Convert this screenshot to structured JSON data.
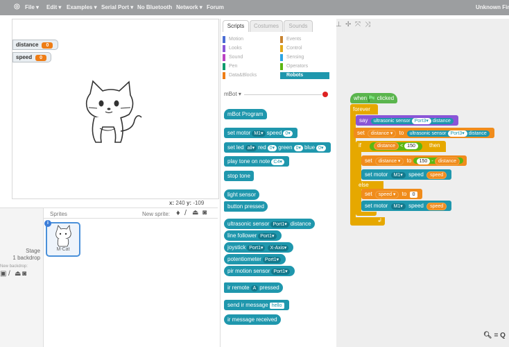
{
  "menu": {
    "items": [
      "File ▾",
      "Edit ▾",
      "Examples ▾",
      "Serial Port ▾",
      "No Bluetooth",
      "Network ▾",
      "Forum"
    ],
    "user": "Unknown Fir"
  },
  "stage": {
    "monitors": [
      {
        "label": "distance",
        "value": "0"
      },
      {
        "label": "speed",
        "value": "0"
      }
    ],
    "coords": {
      "x_label": "x:",
      "x": "240",
      "y_label": "y:",
      "y": "-109"
    }
  },
  "sprites": {
    "header": "Sprites",
    "new_sprite": "New sprite:",
    "sprite_name": "M-Cat",
    "info": "i",
    "stage_label": "Stage",
    "backdrop_count": "1 backdrop",
    "new_backdrop": "New backdrop:"
  },
  "palette": {
    "tabs": [
      "Scripts",
      "Costumes",
      "Sounds"
    ],
    "categories": [
      {
        "name": "Motion",
        "color": "#4a6cd4"
      },
      {
        "name": "Events",
        "color": "#c88330"
      },
      {
        "name": "Looks",
        "color": "#8a55d7"
      },
      {
        "name": "Control",
        "color": "#e1a91a"
      },
      {
        "name": "Sound",
        "color": "#bb42c3"
      },
      {
        "name": "Sensing",
        "color": "#2ca5e2"
      },
      {
        "name": "Pen",
        "color": "#0e9a6c"
      },
      {
        "name": "Operators",
        "color": "#5cb712"
      },
      {
        "name": "Data&Blocks",
        "color": "#ee7d16"
      },
      {
        "name": "Robots",
        "color": "#1f97ad"
      }
    ],
    "device": "mBot ▾",
    "blocks": {
      "program": "mBot Program",
      "set_motor": {
        "a": "set motor",
        "b": "M1▾",
        "c": "speed",
        "d": "0▾"
      },
      "set_led": {
        "a": "set led",
        "b": "all▾",
        "c": "red",
        "d": "0▾",
        "e": "green",
        "f": "0▾",
        "g": "blue",
        "h": "0▾"
      },
      "play_tone": {
        "a": "play tone on note",
        "b": "C4▾"
      },
      "stop_tone": "stop tone",
      "light_sensor": "light sensor",
      "button_pressed": "button pressed",
      "ultrasonic": {
        "a": "ultrasonic sensor",
        "b": "Port1▾",
        "c": "distance"
      },
      "line_follower": {
        "a": "line follower",
        "b": "Port1▾"
      },
      "joystick": {
        "a": "joystick",
        "b": "Port1▾",
        "c": "X-Axis▾"
      },
      "potentiometer": {
        "a": "potentiometer",
        "b": "Port1▾"
      },
      "pir": {
        "a": "pir motion sensor",
        "b": "Port1▾"
      },
      "ir_remote": {
        "a": "ir remote",
        "b": "A",
        "c": "pressed"
      },
      "send_ir": {
        "a": "send ir message",
        "b": "hello"
      },
      "ir_received": "ir message received"
    }
  },
  "script": {
    "when": "when",
    "clicked": "clicked",
    "forever": "forever",
    "say": {
      "a": "say",
      "b": "ultrasonic sensor",
      "c": "Port3▾",
      "d": "distance"
    },
    "set1": {
      "a": "set",
      "b": "distance ▾",
      "c": "to",
      "d": "ultrasonic sensor",
      "e": "Port3▾",
      "f": "distance"
    },
    "if": {
      "a": "if",
      "b": "distance",
      "c": "<",
      "d": "150",
      "e": "then"
    },
    "set2": {
      "a": "set",
      "b": "distance ▾",
      "c": "to",
      "d": "150",
      "e": "-",
      "f": "distance"
    },
    "motor1": {
      "a": "set motor",
      "b": "M1▾",
      "c": "speed",
      "d": "speed"
    },
    "else": "else",
    "set3": {
      "a": "set",
      "b": "speed ▾",
      "c": "to",
      "d": "0"
    },
    "motor2": {
      "a": "set motor",
      "b": "M1▾",
      "c": "speed",
      "d": "speed"
    },
    "zoom": "= Q"
  },
  "colors": {
    "robots": "#1f97ad",
    "data": "#f08c1c",
    "control": "#e6a800",
    "events": "#5ab54d",
    "looks": "#8a55d7",
    "menubar": "#9c9ea0"
  }
}
